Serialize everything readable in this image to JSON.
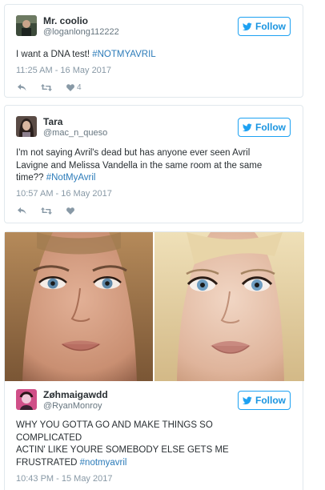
{
  "tweets": [
    {
      "display_name": "Mr. coolio",
      "handle": "@loganlong112222",
      "follow_label": "Follow",
      "text_plain": "I want a DNA test! ",
      "hashtag": "#NOTMYAVRIL",
      "timestamp": "11:25 AM - 16 May 2017",
      "like_count": "4",
      "avatar_icon": "avatar-man-icon"
    },
    {
      "display_name": "Tara",
      "handle": "@mac_n_queso",
      "follow_label": "Follow",
      "text_line1": "I'm not saying Avril's dead but has anyone ever seen Avril",
      "text_line2": "Lavigne and Melissa Vandella in the same room at the same",
      "text_line3": "time?? ",
      "hashtag": "#NotMyAvril",
      "timestamp": "10:57 AM - 16 May 2017",
      "avatar_icon": "avatar-woman-icon"
    },
    {
      "display_name": "Zøhmaigawdd",
      "handle": "@RyanMonroy",
      "follow_label": "Follow",
      "text_line1": "WHY YOU GOTTA GO AND MAKE THINGS SO",
      "text_line2": "COMPLICATED",
      "text_line3": "ACTIN' LIKE YOURE SOMEBODY ELSE GETS ME",
      "text_line4": "FRUSTRATED ",
      "hashtag": "#notmyavril",
      "timestamp": "10:43 PM - 15 May 2017",
      "avatar_icon": "avatar-pink-icon"
    }
  ],
  "colors": {
    "twitter_blue": "#1da1f2",
    "hashtag": "#2b7bb9",
    "muted": "#8899a6",
    "border": "#e1e8ed"
  }
}
